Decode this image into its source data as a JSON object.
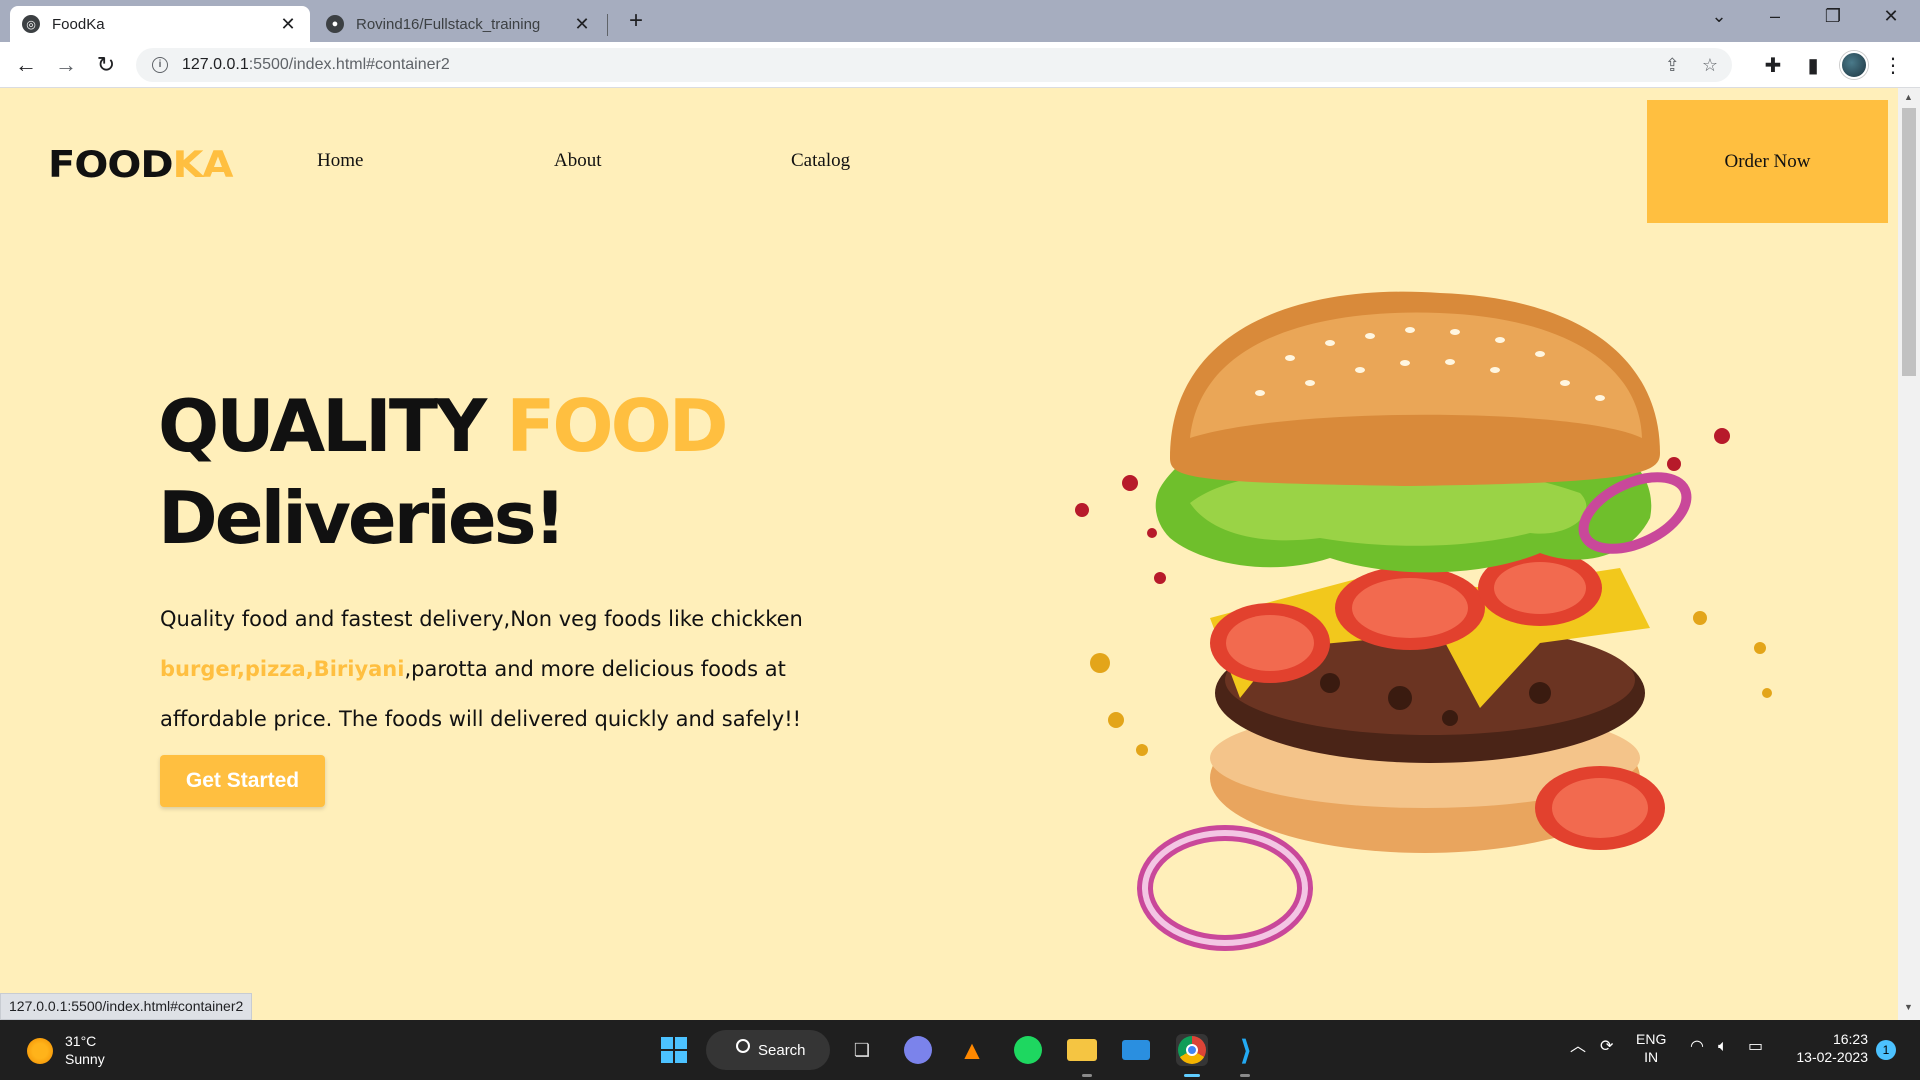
{
  "browser": {
    "tabs": [
      {
        "title": "FoodKa",
        "active": true
      },
      {
        "title": "Rovind16/Fullstack_training",
        "active": false
      }
    ],
    "url_host": "127.0.0.1",
    "url_rest": ":5500/index.html#container2",
    "status_url": "127.0.0.1:5500/index.html#container2"
  },
  "site": {
    "logo_main": "FOOD",
    "logo_accent": "KA",
    "nav": [
      "Home",
      "About",
      "Catalog"
    ],
    "order_button": "Order Now",
    "hero": {
      "title_word1": "QUALITY",
      "title_word2": "FOOD",
      "title_line2": "Deliveries!",
      "text_part1": "Quality food and fastest delivery,Non veg foods like chickken",
      "text_highlight": "burger,pizza,Biriyani",
      "text_part2": ",parotta and more delicious foods at affordable price. The foods will delivered quickly and safely!!",
      "cta": "Get Started"
    }
  },
  "taskbar": {
    "weather_temp": "31°C",
    "weather_desc": "Sunny",
    "search_label": "Search",
    "lang_top": "ENG",
    "lang_bottom": "IN",
    "time": "16:23",
    "date": "13-02-2023",
    "notification_count": "1"
  },
  "colors": {
    "page_bg": "#ffefba",
    "accent": "#ffbf40",
    "text": "#111111"
  }
}
